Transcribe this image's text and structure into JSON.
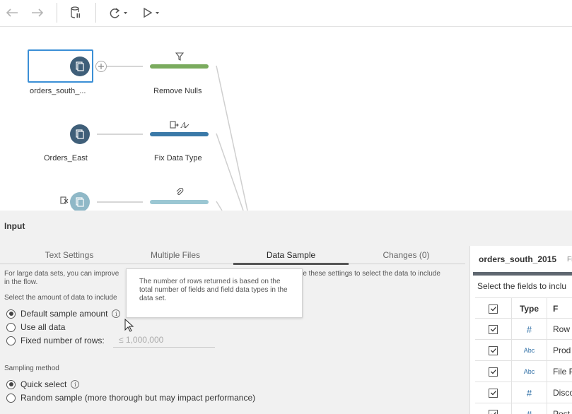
{
  "toolbar": {
    "back_icon": "arrow-left-icon",
    "forward_icon": "arrow-right-icon",
    "pause_icon": "database-pause-icon",
    "refresh_icon": "refresh-icon",
    "run_icon": "play-icon"
  },
  "flow": {
    "inputs": [
      {
        "label": "orders_south_..."
      },
      {
        "label": "Orders_East"
      },
      {
        "label": ""
      }
    ],
    "steps": [
      {
        "label": "Remove Nulls",
        "color": "#7aab5e"
      },
      {
        "label": "Fix Data Type",
        "color": "#3a79a8"
      },
      {
        "label": "",
        "color": "#9bc7d3"
      }
    ]
  },
  "panel": {
    "title": "Input",
    "tabs": [
      {
        "label": "Text Settings",
        "active": false
      },
      {
        "label": "Multiple Files",
        "active": false
      },
      {
        "label": "Data Sample",
        "active": true
      },
      {
        "label": "Changes (0)",
        "active": false
      }
    ],
    "desc_left": "For large data sets, you can improve",
    "desc_right": "se these settings to select the data to include",
    "desc_line2": "in the flow.",
    "amount_label": "Select the amount of data to include",
    "amount_options": [
      {
        "label": "Default sample amount",
        "selected": true
      },
      {
        "label": "Use all data",
        "selected": false
      },
      {
        "label": "Fixed number of rows:",
        "selected": false
      }
    ],
    "rows_placeholder": "≤ 1,000,000",
    "sampling_label": "Sampling method",
    "sampling_options": [
      {
        "label": "Quick select",
        "selected": true
      },
      {
        "label": "Random sample (more thorough but may impact performance)",
        "selected": false
      }
    ],
    "tooltip": "The number of rows returned is based on the total number of fields and field data types in the data set."
  },
  "fields": {
    "title": "orders_south_2015",
    "title_sub": "Fi",
    "select_label": "Select the fields to inclu",
    "header_type": "Type",
    "header_field": "F",
    "rows": [
      {
        "type": "#",
        "name": "Row"
      },
      {
        "type": "Abc",
        "name": "Prod"
      },
      {
        "type": "Abc",
        "name": "File P"
      },
      {
        "type": "#",
        "name": "Disco"
      },
      {
        "type": "#",
        "name": "Post"
      }
    ]
  }
}
